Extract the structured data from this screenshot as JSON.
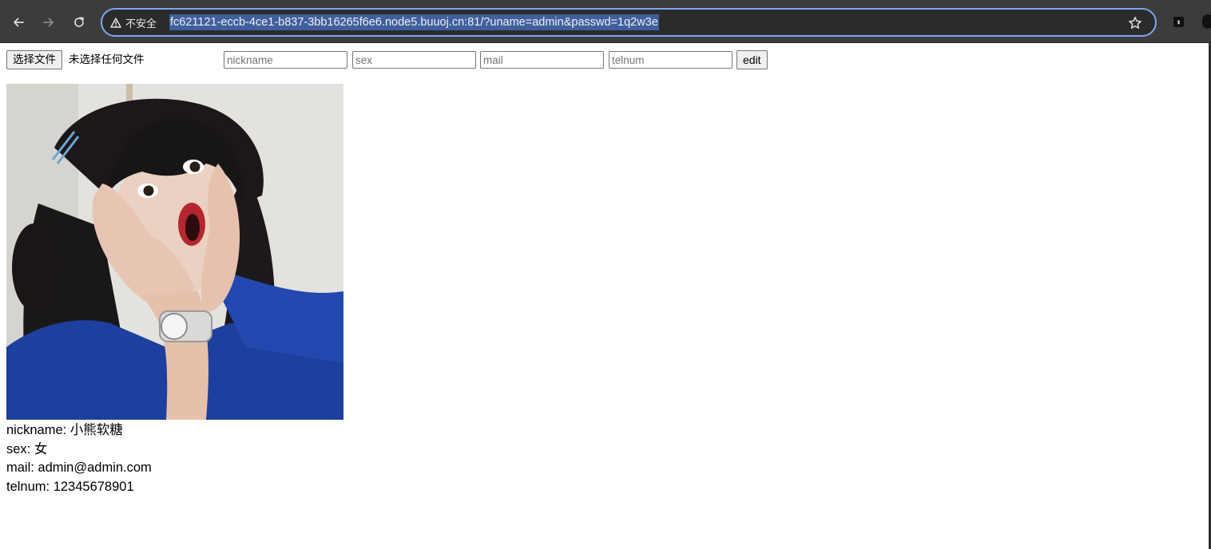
{
  "browser": {
    "security_label": "不安全",
    "url": "fc621121-eccb-4ce1-b837-3bb16265f6e6.node5.buuoj.cn:81/?uname=admin&passwd=1q2w3e"
  },
  "upload": {
    "choose_label": "选择文件",
    "status": "未选择任何文件"
  },
  "form": {
    "nickname_placeholder": "nickname",
    "sex_placeholder": "sex",
    "mail_placeholder": "mail",
    "telnum_placeholder": "telnum",
    "edit_label": "edit"
  },
  "profile": {
    "lines": [
      "nickname: 小熊软糖",
      "sex: 女",
      "mail: admin@admin.com",
      "telnum: 12345678901"
    ]
  },
  "colors": {
    "toolbar_bg": "#3c3c3c",
    "omnibox_border": "#7ea6f2",
    "url_selection": "#3f5f9e"
  },
  "icons": {
    "back": "arrow-left",
    "forward": "arrow-right",
    "reload": "reload",
    "warning": "warning-triangle",
    "bookmark": "star-outline"
  }
}
